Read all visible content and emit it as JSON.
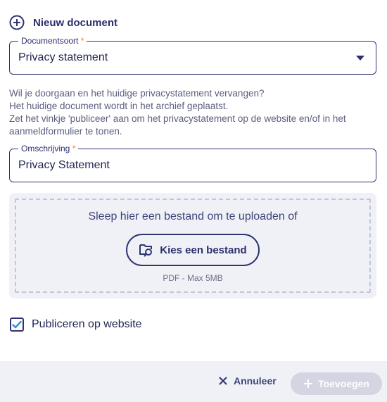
{
  "header": {
    "title": "Nieuw document",
    "icon": "plus-circle-icon"
  },
  "document_type": {
    "label": "Documentsoort",
    "required_mark": "*",
    "value": "Privacy statement"
  },
  "info": {
    "line1": "Wil je doorgaan en het huidige privacystatement vervangen?",
    "line2": "Het huidige document wordt in het archief geplaatst.",
    "line3": "Zet het vinkje 'publiceer' aan om het privacystatement op de website en/of in het aanmeldformulier te tonen."
  },
  "description": {
    "label": "Omschrijving",
    "required_mark": "*",
    "value": "Privacy Statement"
  },
  "upload": {
    "prompt": "Sleep hier een bestand om te uploaden of",
    "button_label": "Kies een bestand",
    "hint": "PDF - Max 5MB"
  },
  "publish": {
    "label": "Publiceren op website",
    "checked": true
  },
  "footer": {
    "cancel_label": "Annuleer",
    "add_label": "Toevoegen"
  },
  "colors": {
    "primary": "#2e3470",
    "accent_required": "#e08a20",
    "checkbox_check": "#2f8fe0",
    "disabled_button": "#d3d5e2"
  }
}
